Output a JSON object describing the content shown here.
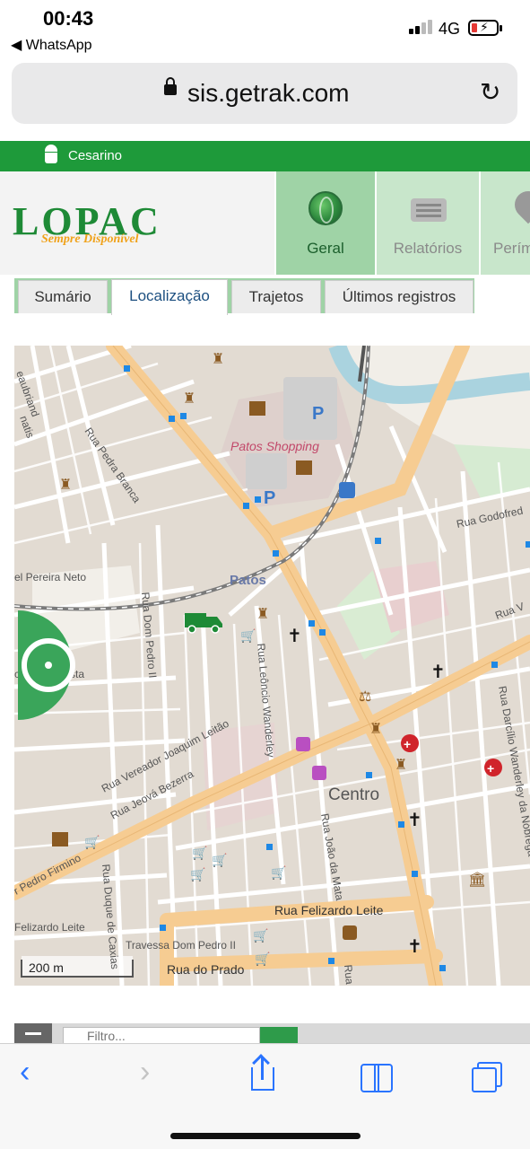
{
  "status_bar": {
    "time": "00:43",
    "back_app": "◀ WhatsApp",
    "network": "4G",
    "battery_level": 0.15
  },
  "browser": {
    "url": "sis.getrak.com"
  },
  "topbar": {
    "user_name": "Cesarino",
    "platform_icons": [
      "apple-icon",
      "android-icon"
    ],
    "color": "#1e9a3a"
  },
  "header": {
    "logo_text": "LOPAC",
    "logo_slogan": "Sempre Disponível",
    "nav": [
      {
        "label": "Geral",
        "icon": "globe-icon",
        "active": true
      },
      {
        "label": "Relatórios",
        "icon": "report-icon",
        "active": false
      },
      {
        "label": "Perím",
        "icon": "pin-icon",
        "active": false
      }
    ]
  },
  "tabs": [
    {
      "label": "Sumário",
      "active": false
    },
    {
      "label": "Localização",
      "active": true
    },
    {
      "label": "Trajetos",
      "active": false
    },
    {
      "label": "Últimos registros",
      "active": false
    }
  ],
  "map": {
    "scale_label": "200 m",
    "labels": {
      "patos_shopping": "Patos Shopping",
      "patos": "Patos",
      "centro": "Centro",
      "rua_pedra_branca": "Rua Pedra Branca",
      "rua_godofredo": "Rua Godofred",
      "rua_v": "Rua V",
      "pereira_neto": "el Pereira Neto",
      "rua_dom_pedro_ii": "Rua Dom Pedro II",
      "cirilo_costa": "co Cirilo Costa",
      "rua_leoncio": "Rua Leôncio Wanderley",
      "rua_vereador": "Rua Vereador Joaquim Leitão",
      "rua_jeova": "Rua Jeová Bezerra",
      "pedro_firmino": "r Pedro Firmino",
      "rua_duque": "Rua Duque de Caxias",
      "rua_joao_mata": "Rua João da Mata",
      "rua_felizardo_1": "Rua Felizardo Leite",
      "rua_felizardo_2": "Felizardo Leite",
      "travessa": "Travessa Dom Pedro II",
      "rua_do_prado": "Rua do Prado",
      "rua_darcilio": "Rua Darcílio Wanderley da Nóbrega",
      "chateaubriand": "eaubriand",
      "matis": "natis",
      "rua_r": "Rua"
    },
    "colors": {
      "main_road": "#f6cc92",
      "street": "#ffffff",
      "block": "#e0d8cf",
      "river": "#aad3df",
      "park": "#cdeccb",
      "rail": "#777777"
    }
  },
  "filter": {
    "placeholder": "Filtro..."
  }
}
